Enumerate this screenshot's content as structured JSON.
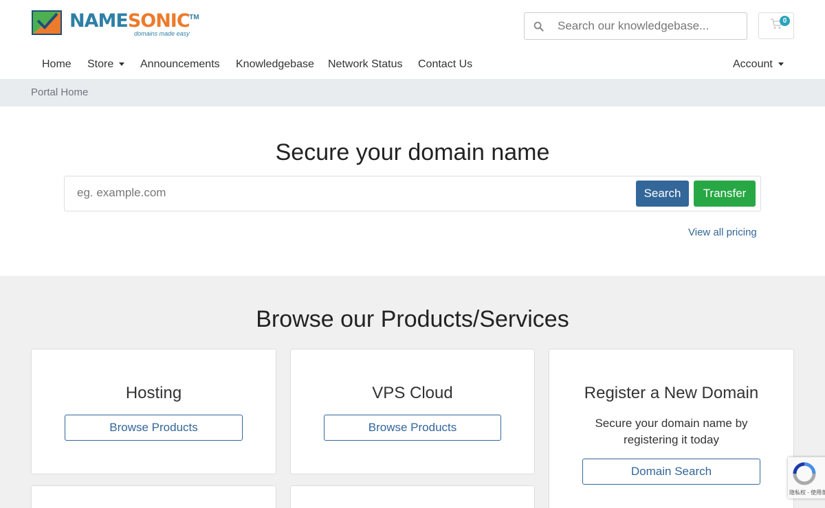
{
  "brand": {
    "name_part1": "NAME",
    "name_part2": "SONIC",
    "trademark": "TM",
    "tagline": "domains made easy"
  },
  "header": {
    "kb_search_placeholder": "Search our knowledgebase...",
    "cart_count": "0"
  },
  "nav": {
    "items": [
      {
        "label": "Home"
      },
      {
        "label": "Store"
      },
      {
        "label": "Announcements"
      },
      {
        "label": "Knowledgebase"
      },
      {
        "label": "Network Status"
      },
      {
        "label": "Contact Us"
      }
    ],
    "account_label": "Account"
  },
  "breadcrumb": {
    "current": "Portal Home"
  },
  "hero": {
    "title": "Secure your domain name",
    "domain_placeholder": "eg. example.com",
    "search_label": "Search",
    "transfer_label": "Transfer",
    "view_pricing_label": "View all pricing"
  },
  "products": {
    "title": "Browse our Products/Services",
    "cards": [
      {
        "title": "Hosting",
        "button_label": "Browse Products"
      },
      {
        "title": "VPS Cloud",
        "button_label": "Browse Products"
      },
      {
        "title": "Register a New Domain",
        "description": "Secure your domain name by registering it today",
        "button_label": "Domain Search"
      }
    ]
  },
  "recaptcha": {
    "text": "隐私权 - 使用条款"
  },
  "colors": {
    "primary": "#336699",
    "success": "#28a745",
    "brand_blue": "#2e7fa6",
    "brand_orange": "#ec7b2c",
    "cart_badge": "#29a4bb",
    "breadcrumb_bg": "#e9ecef",
    "section_bg": "#f0f0f0"
  }
}
